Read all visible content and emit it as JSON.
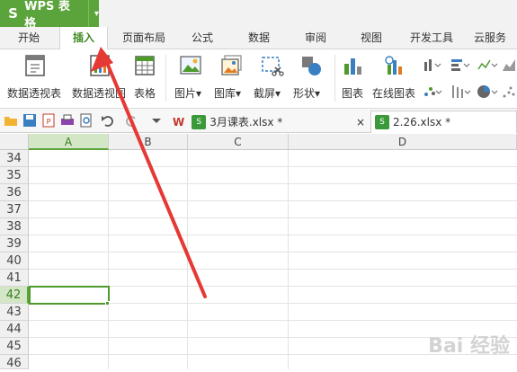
{
  "app": {
    "logo": "S",
    "name": "WPS 表格",
    "dropdown": "▾"
  },
  "menu_tabs": [
    "开始",
    "插入",
    "页面布局",
    "公式",
    "数据",
    "审阅",
    "视图",
    "开发工具",
    "云服务"
  ],
  "active_tab": "插入",
  "ribbon": {
    "pivot_table": "数据透视表",
    "pivot_chart": "数据透视图",
    "table": "表格",
    "picture": "图片",
    "gallery": "图库",
    "screenshot": "截屏",
    "shapes": "形状",
    "chart": "图表",
    "online_chart": "在线图表",
    "dropdown_arrow": "▾"
  },
  "documents": [
    {
      "name": "3月课表.xlsx *",
      "close": "×"
    },
    {
      "name": "2.26.xlsx *"
    }
  ],
  "columns": [
    "A",
    "B",
    "C",
    "D"
  ],
  "rows": [
    "34",
    "35",
    "36",
    "37",
    "38",
    "39",
    "40",
    "41",
    "42",
    "43",
    "44",
    "45",
    "46"
  ],
  "selected_cell": {
    "column": "A",
    "row": "42"
  },
  "watermark": "Bai 经验",
  "colors": {
    "brand_green": "#5ba33b",
    "arrow_red": "#e53935"
  },
  "icons": [
    "folder-open-icon",
    "save-icon",
    "pdf-icon",
    "print-icon",
    "print-preview-icon",
    "undo-icon",
    "redo-icon",
    "more-icon"
  ]
}
